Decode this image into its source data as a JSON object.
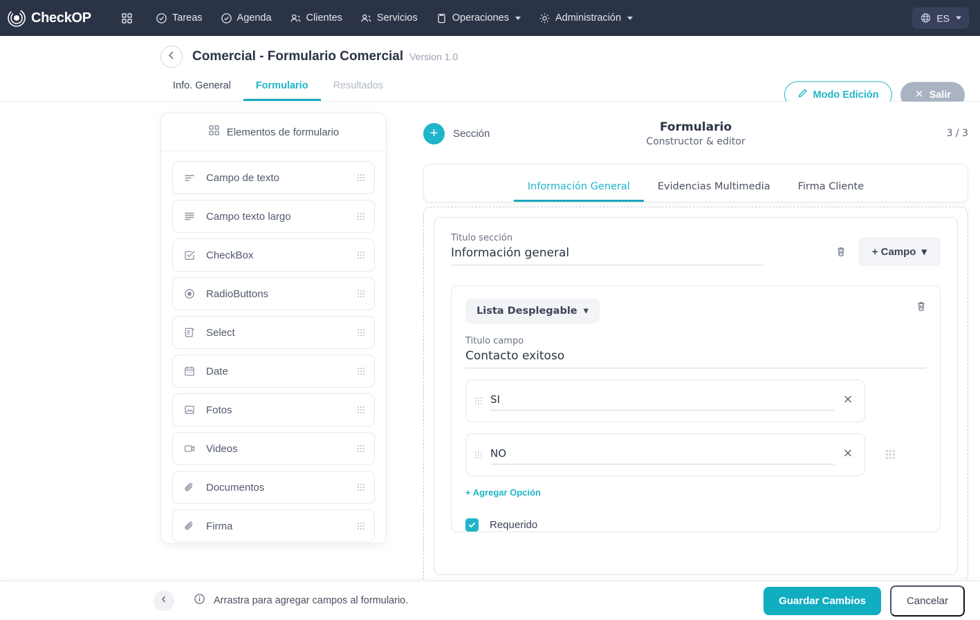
{
  "topnav": {
    "brand": "CheckOP",
    "items": [
      {
        "label": "",
        "icon": "grid-icon",
        "caret": false
      },
      {
        "label": "Tareas",
        "icon": "check-circle-icon",
        "caret": false
      },
      {
        "label": "Agenda",
        "icon": "check-circle-icon",
        "caret": false
      },
      {
        "label": "Clientes",
        "icon": "users-icon",
        "caret": false
      },
      {
        "label": "Servicios",
        "icon": "users-icon",
        "caret": false
      },
      {
        "label": "Operaciones",
        "icon": "clipboard-icon",
        "caret": true
      },
      {
        "label": "Administración",
        "icon": "gear-icon",
        "caret": true
      }
    ],
    "language": "ES"
  },
  "header": {
    "back_icon": "arrow-left-icon",
    "title": "Comercial - Formulario Comercial",
    "version": "Version 1.0",
    "tabs": [
      {
        "label": "Info. General",
        "state": "normal"
      },
      {
        "label": "Formulario",
        "state": "active"
      },
      {
        "label": "Resultados",
        "state": "muted"
      }
    ],
    "edit_button": "Modo Edición",
    "exit_button": "Salir"
  },
  "palette": {
    "heading": "Elementos de formulario",
    "heading_icon": "grid-icon",
    "items": [
      {
        "label": "Campo de texto",
        "icon": "text-lines-icon"
      },
      {
        "label": "Campo texto largo",
        "icon": "paragraph-icon"
      },
      {
        "label": "CheckBox",
        "icon": "checkbox-icon"
      },
      {
        "label": "RadioButtons",
        "icon": "radio-icon"
      },
      {
        "label": "Select",
        "icon": "select-icon"
      },
      {
        "label": "Date",
        "icon": "calendar-icon"
      },
      {
        "label": "Fotos",
        "icon": "image-icon"
      },
      {
        "label": "Videos",
        "icon": "video-icon"
      },
      {
        "label": "Documentos",
        "icon": "paperclip-icon"
      },
      {
        "label": "Firma",
        "icon": "paperclip-icon"
      }
    ]
  },
  "builder": {
    "add_section_label": "Sección",
    "title": "Formulario",
    "subtitle": "Constructor & editor",
    "page_count": "3 / 3",
    "tabs": [
      {
        "label": "Información General",
        "state": "active"
      },
      {
        "label": "Evidencias Multimedia",
        "state": "normal"
      },
      {
        "label": "Firma Cliente",
        "state": "normal"
      }
    ],
    "section": {
      "title_label": "Titulo sección",
      "title_value": "Información general",
      "delete_icon": "trash-icon",
      "add_field_label": "+ Campo",
      "field": {
        "type_chip": "Lista Desplegable",
        "delete_icon": "trash-icon",
        "title_label": "Titulo campo",
        "title_value": "Contacto exitoso",
        "options": [
          {
            "value": "SI"
          },
          {
            "value": "NO"
          }
        ],
        "add_option_label": "+ Agregar Opción",
        "required_label": "Requerido",
        "required_checked": true
      }
    }
  },
  "bottombar": {
    "collapse_icon": "chevron-left-icon",
    "info_icon": "info-icon",
    "hint": "Arrastra para agregar campos al formulario.",
    "save_label": "Guardar Cambios",
    "cancel_label": "Cancelar"
  },
  "colors": {
    "accent": "#1eb5c8",
    "accent_dark": "#11aec2",
    "nav_bg": "#2b3346",
    "text": "#2b3346"
  }
}
